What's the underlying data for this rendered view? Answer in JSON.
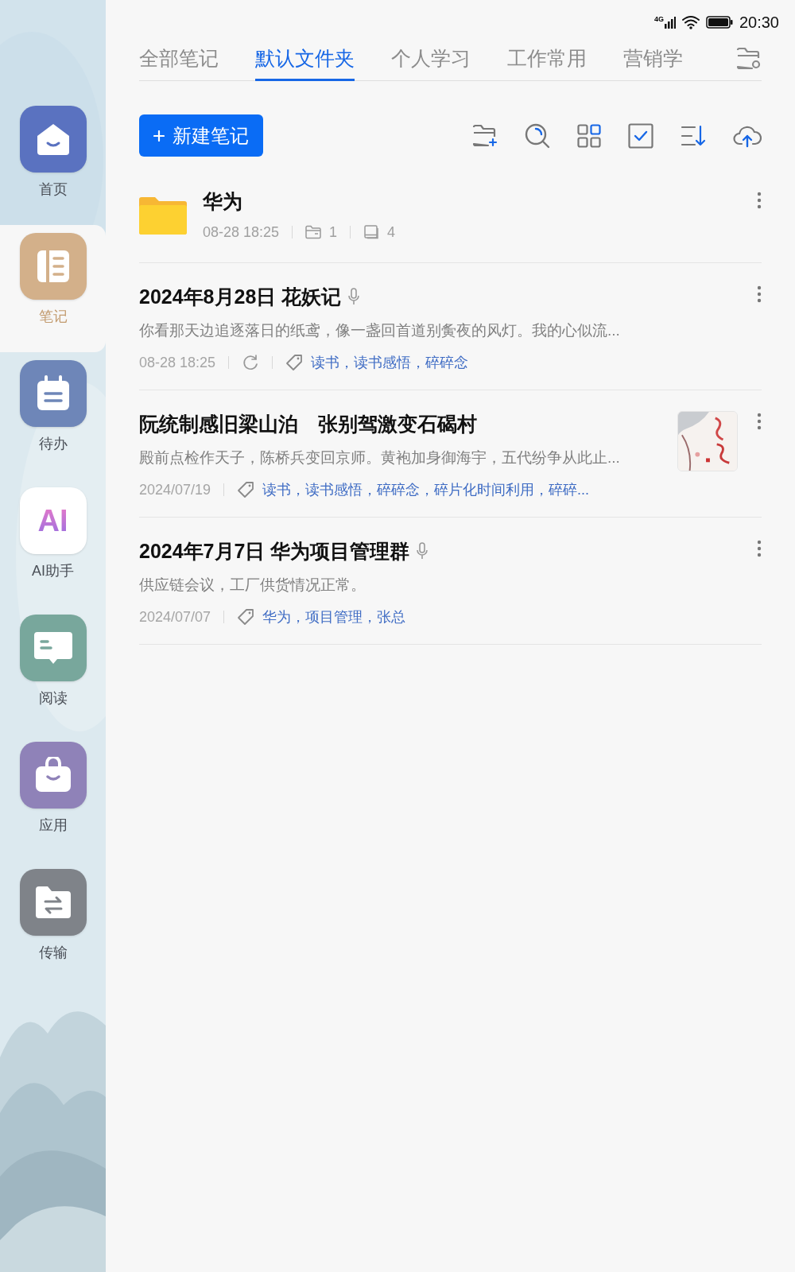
{
  "status_bar": {
    "network": "4G",
    "time": "20:30"
  },
  "sidebar": {
    "items": [
      {
        "kind": "home",
        "label": "首页",
        "selected": false
      },
      {
        "kind": "notes",
        "label": "笔记",
        "selected": true
      },
      {
        "kind": "todo",
        "label": "待办",
        "selected": false
      },
      {
        "kind": "ai",
        "icon_text": "AI",
        "label": "AI助手",
        "selected": false
      },
      {
        "kind": "reading",
        "label": "阅读",
        "selected": false
      },
      {
        "kind": "apps",
        "label": "应用",
        "selected": false
      },
      {
        "kind": "transfer",
        "label": "传输",
        "selected": false
      }
    ]
  },
  "tabs": [
    {
      "label": "全部笔记",
      "selected": false
    },
    {
      "label": "默认文件夹",
      "selected": true
    },
    {
      "label": "个人学习",
      "selected": false
    },
    {
      "label": "工作常用",
      "selected": false
    },
    {
      "label": "营销学",
      "selected": false
    }
  ],
  "new_note_button": {
    "label": "新建笔记"
  },
  "folders": [
    {
      "name": "华为",
      "time": "08-28 18:25",
      "subfolder_count": "1",
      "note_count": "4"
    }
  ],
  "notes": [
    {
      "title": "2024年8月28日 花妖记",
      "voice": true,
      "preview": "你看那天边追逐落日的纸鸢，像一盏回首道别夤夜的风灯。我的心似流...",
      "time": "08-28 18:25",
      "syncing": true,
      "tags": "读书，读书感悟，碎碎念",
      "thumbnail": false
    },
    {
      "title": "阮统制感旧梁山泊　张别驾激变石碣村",
      "voice": false,
      "preview": "殿前点检作天子，陈桥兵变回京师。黄袍加身御海宇，五代纷争从此止...",
      "time": "2024/07/19",
      "syncing": false,
      "tags": "读书，读书感悟，碎碎念，碎片化时间利用，碎碎...",
      "thumbnail": true
    },
    {
      "title": "2024年7月7日 华为项目管理群",
      "voice": true,
      "preview": "供应链会议，工厂供货情况正常。",
      "time": "2024/07/07",
      "syncing": false,
      "tags": "华为，项目管理，张总",
      "thumbnail": false
    }
  ]
}
